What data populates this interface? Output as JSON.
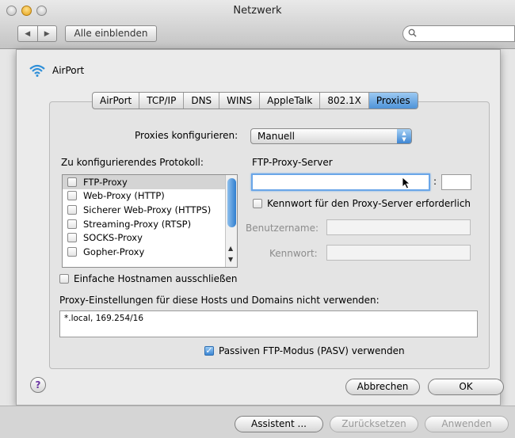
{
  "window": {
    "title": "Netzwerk",
    "show_all": "Alle einblenden",
    "nav_back": "◀",
    "nav_forward": "▶"
  },
  "search": {
    "placeholder": ""
  },
  "interface": {
    "name": "AirPort"
  },
  "tabs": [
    {
      "label": "AirPort",
      "selected": false
    },
    {
      "label": "TCP/IP",
      "selected": false
    },
    {
      "label": "DNS",
      "selected": false
    },
    {
      "label": "WINS",
      "selected": false
    },
    {
      "label": "AppleTalk",
      "selected": false
    },
    {
      "label": "802.1X",
      "selected": false
    },
    {
      "label": "Proxies",
      "selected": true
    }
  ],
  "configure": {
    "label": "Proxies konfigurieren:",
    "value": "Manuell"
  },
  "protocols": {
    "heading": "Zu konfigurierendes Protokoll:",
    "items": [
      {
        "label": "FTP-Proxy",
        "checked": false,
        "selected": true
      },
      {
        "label": "Web-Proxy (HTTP)",
        "checked": false,
        "selected": false
      },
      {
        "label": "Sicherer Web-Proxy (HTTPS)",
        "checked": false,
        "selected": false
      },
      {
        "label": "Streaming-Proxy (RTSP)",
        "checked": false,
        "selected": false
      },
      {
        "label": "SOCKS-Proxy",
        "checked": false,
        "selected": false
      },
      {
        "label": "Gopher-Proxy",
        "checked": false,
        "selected": false
      }
    ]
  },
  "server": {
    "heading": "FTP-Proxy-Server",
    "host_value": "",
    "separator": ":",
    "port_value": "",
    "password_required_label": "Kennwort für den Proxy-Server erforderlich",
    "password_required_checked": false,
    "username_label": "Benutzername:",
    "username_value": "",
    "password_label": "Kennwort:",
    "password_value": ""
  },
  "exclude_simple": {
    "label": "Einfache Hostnamen ausschließen",
    "checked": false
  },
  "bypass": {
    "label": "Proxy-Einstellungen für diese Hosts und Domains nicht verwenden:",
    "value": "*.local, 169.254/16"
  },
  "passive_ftp": {
    "label": "Passiven FTP-Modus (PASV) verwenden",
    "checked": true
  },
  "buttons": {
    "help": "?",
    "cancel": "Abbrechen",
    "ok": "OK",
    "assistant": "Assistent ...",
    "revert": "Zurücksetzen",
    "apply": "Anwenden"
  },
  "colors": {
    "accent": "#3b86d4",
    "selected_tab": "#4f93d8"
  }
}
